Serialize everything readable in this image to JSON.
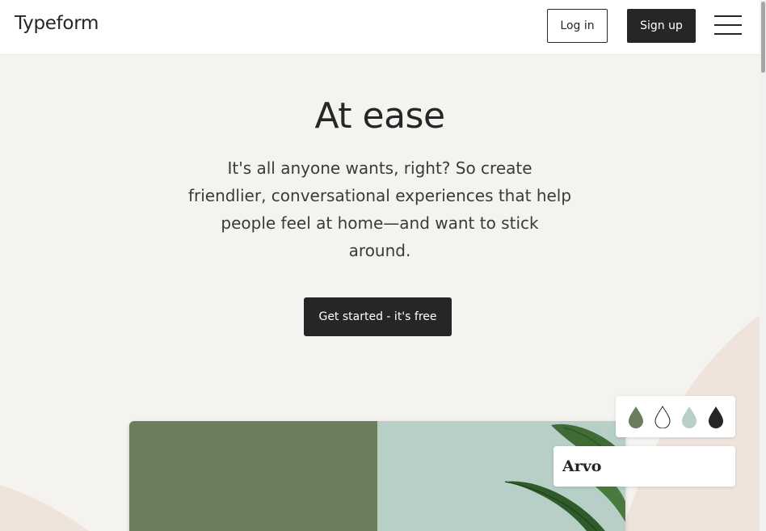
{
  "header": {
    "logo": "Typeform",
    "login_label": "Log in",
    "signup_label": "Sign up",
    "menu_icon": "hamburger-menu-icon"
  },
  "hero": {
    "title": "At ease",
    "text": "It's all anyone wants, right? So create friendlier, conversational experiences that help people feel at home—and want to stick around.",
    "cta_label": "Get started - it's free"
  },
  "theme_picker": {
    "drops": [
      {
        "name": "green-drop-icon",
        "color": "#6a7d5d",
        "outlined": false
      },
      {
        "name": "white-drop-icon",
        "color": "#ffffff",
        "outlined": true
      },
      {
        "name": "mint-drop-icon",
        "color": "#b7cfc6",
        "outlined": false
      },
      {
        "name": "black-drop-icon",
        "color": "#262627",
        "outlined": false
      }
    ],
    "font_name": "Arvo"
  },
  "colors": {
    "background": "#f5f3f0",
    "dark": "#262627",
    "accent_green": "#6a7d5d",
    "accent_mint": "#b7cfc6",
    "shape_peach": "#efe4dc"
  }
}
